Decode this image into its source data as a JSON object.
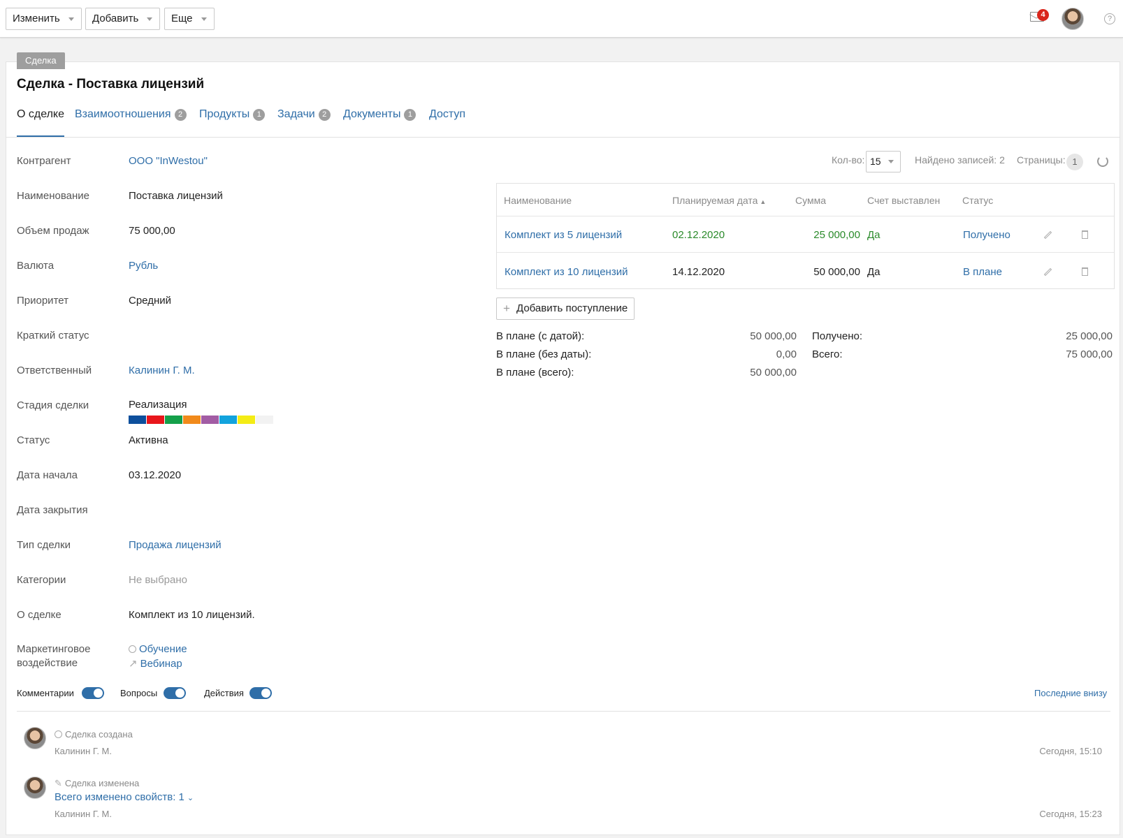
{
  "toolbar": {
    "edit_label": "Изменить",
    "add_label": "Добавить",
    "more_label": "Еще",
    "mail_count": "4",
    "help": "?"
  },
  "header": {
    "type_tag": "Сделка",
    "title": "Сделка - Поставка лицензий"
  },
  "tabs": [
    {
      "label": "О сделке",
      "count": ""
    },
    {
      "label": "Взаимоотношения",
      "count": "2"
    },
    {
      "label": "Продукты",
      "count": "1"
    },
    {
      "label": "Задачи",
      "count": "2"
    },
    {
      "label": "Документы",
      "count": "1"
    },
    {
      "label": "Доступ",
      "count": ""
    }
  ],
  "fields": {
    "counterparty": {
      "label": "Контрагент",
      "value": "ООО \"InWestou\""
    },
    "name": {
      "label": "Наименование",
      "value": "Поставка лицензий"
    },
    "volume": {
      "label": "Объем продаж",
      "value": "75 000,00"
    },
    "currency": {
      "label": "Валюта",
      "value": "Рубль"
    },
    "priority": {
      "label": "Приоритет",
      "value": "Средний"
    },
    "short_status": {
      "label": "Краткий статус",
      "value": ""
    },
    "responsible": {
      "label": "Ответственный",
      "value": "Калинин Г. М."
    },
    "stage": {
      "label": "Стадия сделки",
      "value": "Реализация",
      "colors": [
        "#0d4f9c",
        "#e8161b",
        "#14a04a",
        "#f18a1b",
        "#a25ca4",
        "#12a3dd",
        "#f4ec15",
        "#f2f2f2"
      ]
    },
    "status": {
      "label": "Статус",
      "value": "Активна"
    },
    "start_date": {
      "label": "Дата начала",
      "value": "03.12.2020"
    },
    "close_date": {
      "label": "Дата закрытия",
      "value": ""
    },
    "deal_type": {
      "label": "Тип сделки",
      "value": "Продажа лицензий"
    },
    "categories": {
      "label": "Категории",
      "value": "Не выбрано"
    },
    "about": {
      "label": "О сделке",
      "value": "Комплект из 10 лицензий."
    },
    "marketing": {
      "label_line1": "Маркетинговое",
      "label_line2": "воздействие",
      "items": [
        "Обучение",
        "Вебинар"
      ]
    }
  },
  "payments": {
    "qty_label": "Кол-во:",
    "qty_value": "15",
    "found_label": "Найдено записей: 2",
    "pages_label": "Страницы:",
    "page": "1",
    "columns": [
      "Наименование",
      "Планируемая дата",
      "Сумма",
      "Счет выставлен",
      "Статус"
    ],
    "rows": [
      {
        "name": "Комплект из 5 лицензий",
        "date": "02.12.2020",
        "sum": "25 000,00",
        "invoiced": "Да",
        "status": "Получено"
      },
      {
        "name": "Комплект из 10 лицензий",
        "date": "14.12.2020",
        "sum": "50 000,00",
        "invoiced": "Да",
        "status": "В плане"
      }
    ],
    "add_label": "Добавить поступление",
    "summary": {
      "plan_dated_label": "В плане (с датой):",
      "plan_dated": "50 000,00",
      "plan_undated_label": "В плане (без даты):",
      "plan_undated": "0,00",
      "plan_total_label": "В плане (всего):",
      "plan_total": "50 000,00",
      "received_label": "Получено:",
      "received": "25 000,00",
      "total_label": "Всего:",
      "total": "75 000,00"
    }
  },
  "feed": {
    "toggles": [
      "Комментарии",
      "Вопросы",
      "Действия"
    ],
    "order_label": "Последние внизу",
    "events": [
      {
        "event": "Сделка создана",
        "author": "Калинин Г. М.",
        "time": "Сегодня, 15:10"
      },
      {
        "event": "Сделка изменена",
        "changes": "Всего изменено свойств: 1",
        "author": "Калинин Г. М.",
        "time": "Сегодня, 15:23"
      }
    ]
  }
}
